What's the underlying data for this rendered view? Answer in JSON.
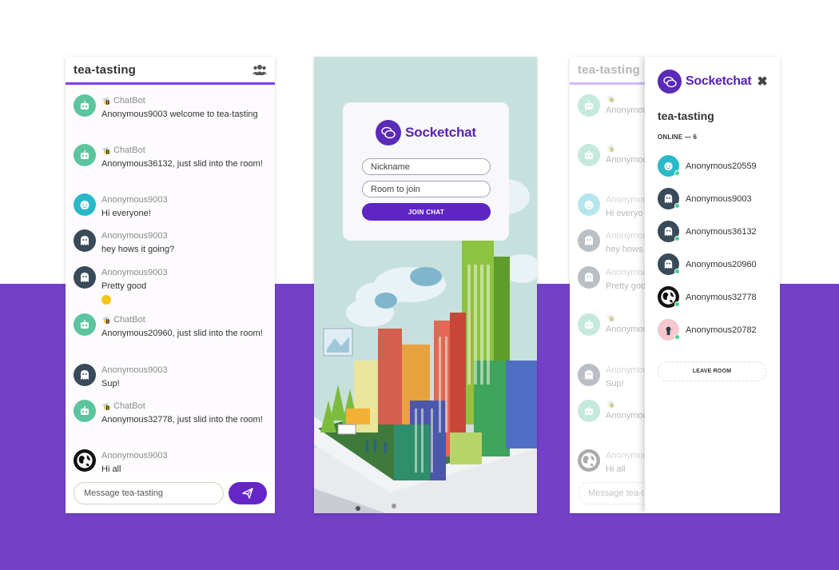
{
  "room": "tea-tasting",
  "chat": {
    "messages": [
      {
        "sender": "ChatBot",
        "text": "Anonymous9003 welcome to tea-tasting",
        "avatar": "robot-icon",
        "bot": true
      },
      {
        "sender": "ChatBot",
        "text": "Anonymous36132, just slid into the room!",
        "avatar": "robot-icon",
        "bot": true
      },
      {
        "sender": "Anonymous9003",
        "text": "Hi everyone!",
        "avatar": "baby-face-icon",
        "bot": false
      },
      {
        "sender": "Anonymous9003",
        "text": "hey hows it going?",
        "avatar": "ghost-icon",
        "bot": false
      },
      {
        "sender": "Anonymous9003",
        "text": "Pretty good",
        "avatar": "ghost-icon",
        "bot": false,
        "emoji": "smiley-emoji"
      },
      {
        "sender": "ChatBot",
        "text": "Anonymous20960, just slid into the room!",
        "avatar": "robot-icon",
        "bot": true
      },
      {
        "sender": "Anonymous9003",
        "text": "Sup!",
        "avatar": "ghost-icon",
        "bot": false
      },
      {
        "sender": "ChatBot",
        "text": "Anonymous32778, just slid into the room!",
        "avatar": "robot-icon",
        "bot": true
      },
      {
        "sender": "Anonymous9003",
        "text": "Hi all",
        "avatar": "globe-icon",
        "bot": false
      }
    ],
    "composer_placeholder": "Message tea-tasting",
    "composer_placeholder_short": "Message tea-t"
  },
  "bg_chat_cut": [
    {
      "sender": "",
      "text": "Anonymou welcom tasting"
    },
    {
      "sender": "",
      "text": "Anonymou room!"
    },
    {
      "sender": "Anonymou",
      "text": "Hi everyo"
    },
    {
      "sender": "Anonymou",
      "text": "hey hows"
    },
    {
      "sender": "Anonymou",
      "text": "Pretty goo"
    },
    {
      "sender": "",
      "text": "Anonymou room!"
    },
    {
      "sender": "Anonymou",
      "text": "Sup!"
    },
    {
      "sender": "",
      "text": "Anonymou room!"
    },
    {
      "sender": "Anonymou",
      "text": "Hi all"
    }
  ],
  "login": {
    "brand": "Socketchat",
    "nickname_placeholder": "Nickname",
    "room_placeholder": "Room to join",
    "join_label": "JOIN CHAT"
  },
  "drawer": {
    "brand": "Socketchat",
    "room": "tea-tasting",
    "online_label": "ONLINE — 6",
    "users": [
      {
        "name": "Anonymous20559",
        "avatar": "baby-face-icon"
      },
      {
        "name": "Anonymous9003",
        "avatar": "ghost-icon"
      },
      {
        "name": "Anonymous36132",
        "avatar": "ghost-icon"
      },
      {
        "name": "Anonymous20960",
        "avatar": "ghost-icon"
      },
      {
        "name": "Anonymous32778",
        "avatar": "globe-icon"
      },
      {
        "name": "Anonymous20782",
        "avatar": "duck-icon"
      }
    ],
    "leave_label": "LEAVE ROOM"
  },
  "colors": {
    "accent": "#6526c7",
    "brand_text": "#5a22b5",
    "background_bottom": "#7540c8",
    "online_dot": "#45d08a"
  }
}
